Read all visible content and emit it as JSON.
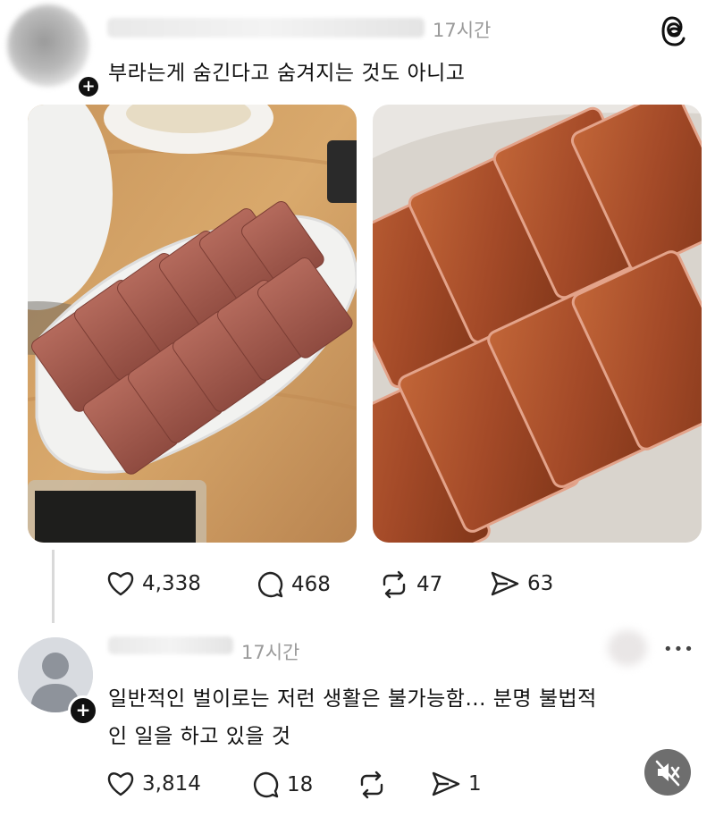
{
  "post": {
    "time": "17시간",
    "text": "부라는게 숨긴다고 숨겨지는 것도 아니고",
    "actions": {
      "likes": "4,338",
      "comments": "468",
      "reposts": "47",
      "shares": "63"
    }
  },
  "reply": {
    "time": "17시간",
    "more": "•••",
    "text_line1": "일반적인 벌이로는 저런 생활은 불가능함... 분명 불법적",
    "text_line2": "인 일을 하고 있을 것",
    "actions": {
      "likes": "3,814",
      "comments": "18",
      "shares": "1"
    }
  },
  "icons": {
    "brand": "threads-logo-icon",
    "follow": "plus-badge-icon",
    "like": "heart-icon",
    "comment": "comment-bubble-icon",
    "repost": "repost-icon",
    "share": "send-icon",
    "mute": "speaker-muted-icon"
  },
  "colors": {
    "text": "#111111",
    "muted": "#9a9a9a",
    "divider": "#d9d9d9"
  }
}
